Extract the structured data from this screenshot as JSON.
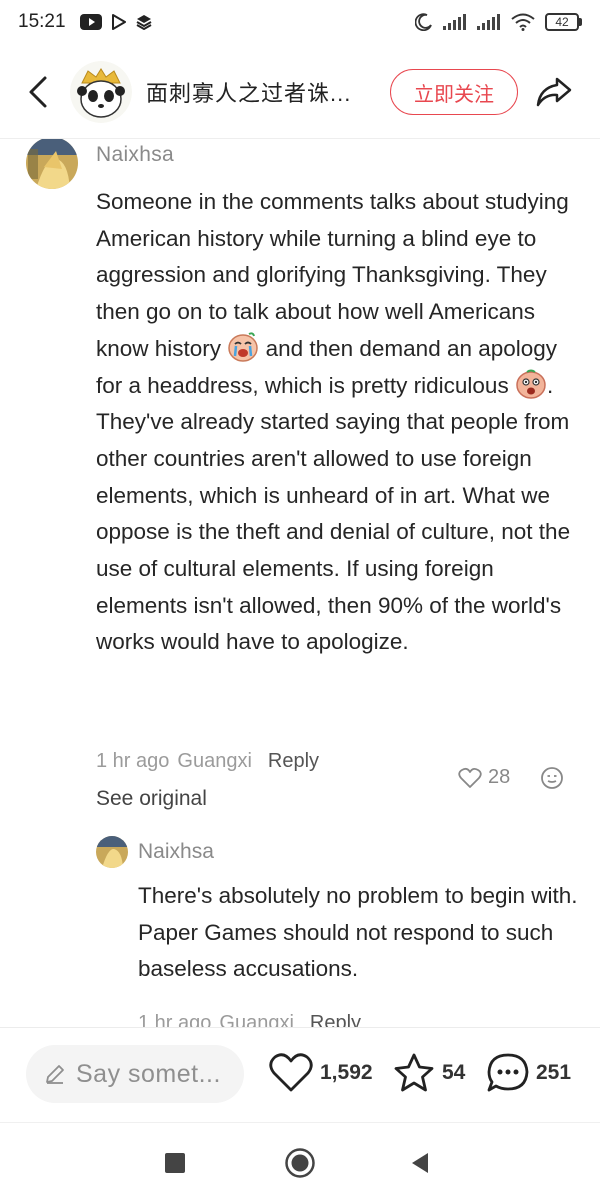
{
  "status_bar": {
    "time": "15:21",
    "battery": "42",
    "icons": [
      "youtube-icon",
      "play-store-icon",
      "layers-icon",
      "moon-icon",
      "signal-icon",
      "signal-icon",
      "wifi-icon",
      "battery-icon"
    ]
  },
  "header": {
    "title": "面刺寡人之过者诛...",
    "follow_label": "立即关注",
    "accent_color": "#e8474f"
  },
  "comment": {
    "username": "Naixhsa",
    "text_part1": "Someone in the comments talks about studying American history while turning a blind eye to aggression and glorifying Thanksgiving. They then go on to talk about how well Americans know history ",
    "text_part2": " and then demand an apology for a headdress, which is pretty ridiculous ",
    "text_part3": ". They've already started saying that people from other countries aren't allowed to use foreign elements, which is unheard of in art. What we oppose is the theft and denial of culture, not the use of cultural elements. If using foreign elements isn't allowed, then 90% of the world's works would have to apologize.",
    "time": "1 hr ago",
    "location": "Guangxi",
    "reply_label": "Reply",
    "likes": "28",
    "see_original": "See original"
  },
  "reply": {
    "username": "Naixhsa",
    "text": "There's absolutely no problem to begin with. Paper Games should not respond to such baseless accusations.",
    "time": "1 hr ago",
    "location": "Guangxi",
    "reply_label": "Reply"
  },
  "bottom_bar": {
    "input_placeholder": "Say somet...",
    "likes": "1,592",
    "favorites": "54",
    "comments": "251"
  }
}
